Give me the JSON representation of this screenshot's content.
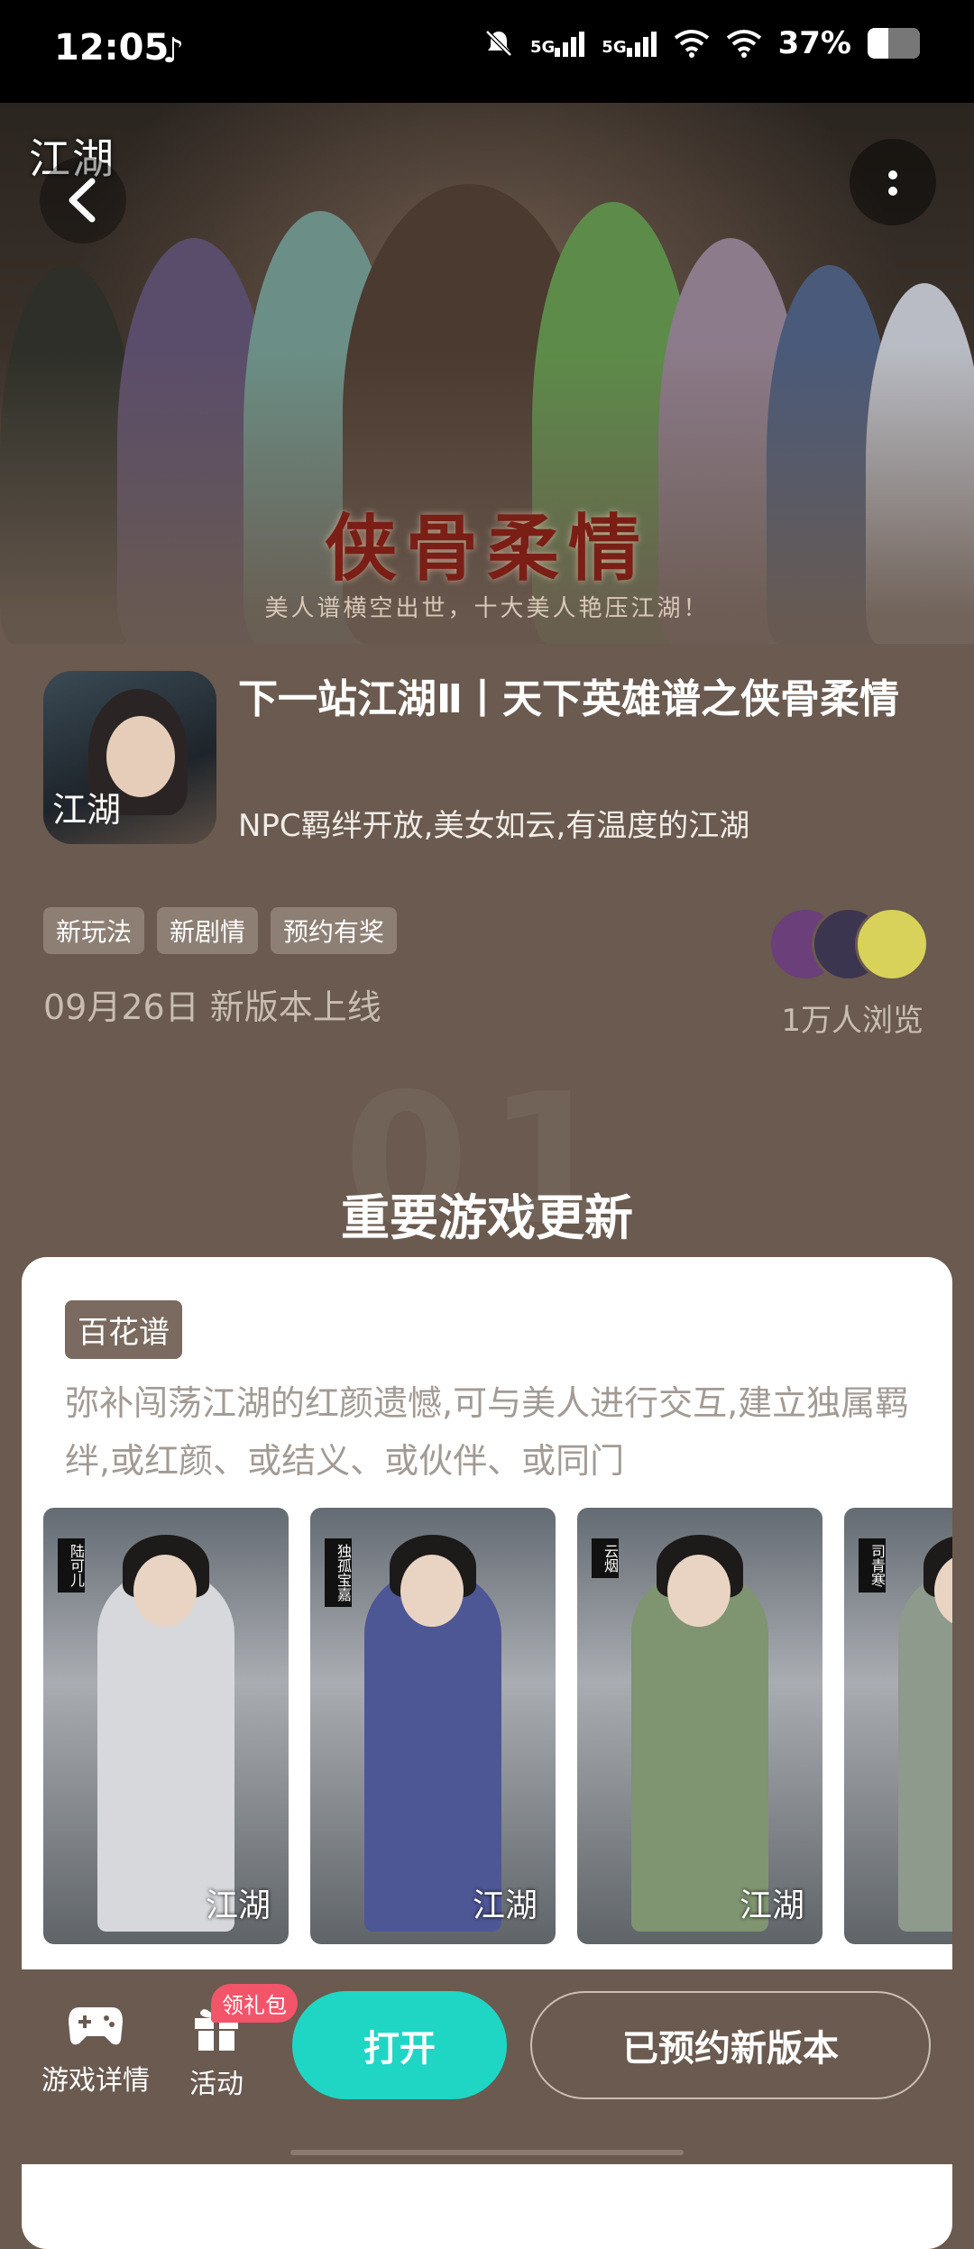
{
  "status_bar": {
    "time": "12:05",
    "network_1": "5G",
    "network_2": "5G",
    "battery": "37%",
    "battery_level": 0.37,
    "icons": [
      "tiktok-icon",
      "mute-icon",
      "signal-icon",
      "signal-icon",
      "wifi-icon",
      "wifi-icon",
      "battery-icon"
    ]
  },
  "hero": {
    "logo": "江湖",
    "title": "侠骨柔情",
    "subtitle": "美人谱横空出世，十大美人艳压江湖！"
  },
  "app": {
    "icon_text": "江湖",
    "title": "下一站江湖Ⅱ丨天下英雄谱之侠骨柔情",
    "subtitle": "NPC羁绊开放,美女如云,有温度的江湖",
    "tags": [
      "新玩法",
      "新剧情",
      "预约有奖"
    ],
    "release": "09月26日 新版本上线",
    "viewers": "1万人浏览"
  },
  "section": {
    "number": "01",
    "title": "重要游戏更新"
  },
  "card": {
    "badge": "百花谱",
    "description": "弥补闯荡江湖的红颜遗憾,可与美人进行交互,建立独属羁绊,或红颜、或结义、或伙伴、或同门",
    "characters": [
      {
        "name": "陆可儿",
        "logo": "江湖",
        "color": "#d6d8dc"
      },
      {
        "name": "独孤宝嘉",
        "logo": "江湖",
        "color": "#4d5796"
      },
      {
        "name": "云烟",
        "logo": "江湖",
        "color": "#7f9470"
      },
      {
        "name": "司青寒",
        "logo": "",
        "color": "#8d9a8c"
      }
    ]
  },
  "bottom_bar": {
    "game_details": "游戏详情",
    "activity": "活动",
    "gift_badge": "领礼包",
    "open": "打开",
    "reserved": "已预约新版本"
  },
  "colors": {
    "background": "#6a5a4f",
    "accent": "#1fd6c4",
    "badge": "#f2546a"
  }
}
